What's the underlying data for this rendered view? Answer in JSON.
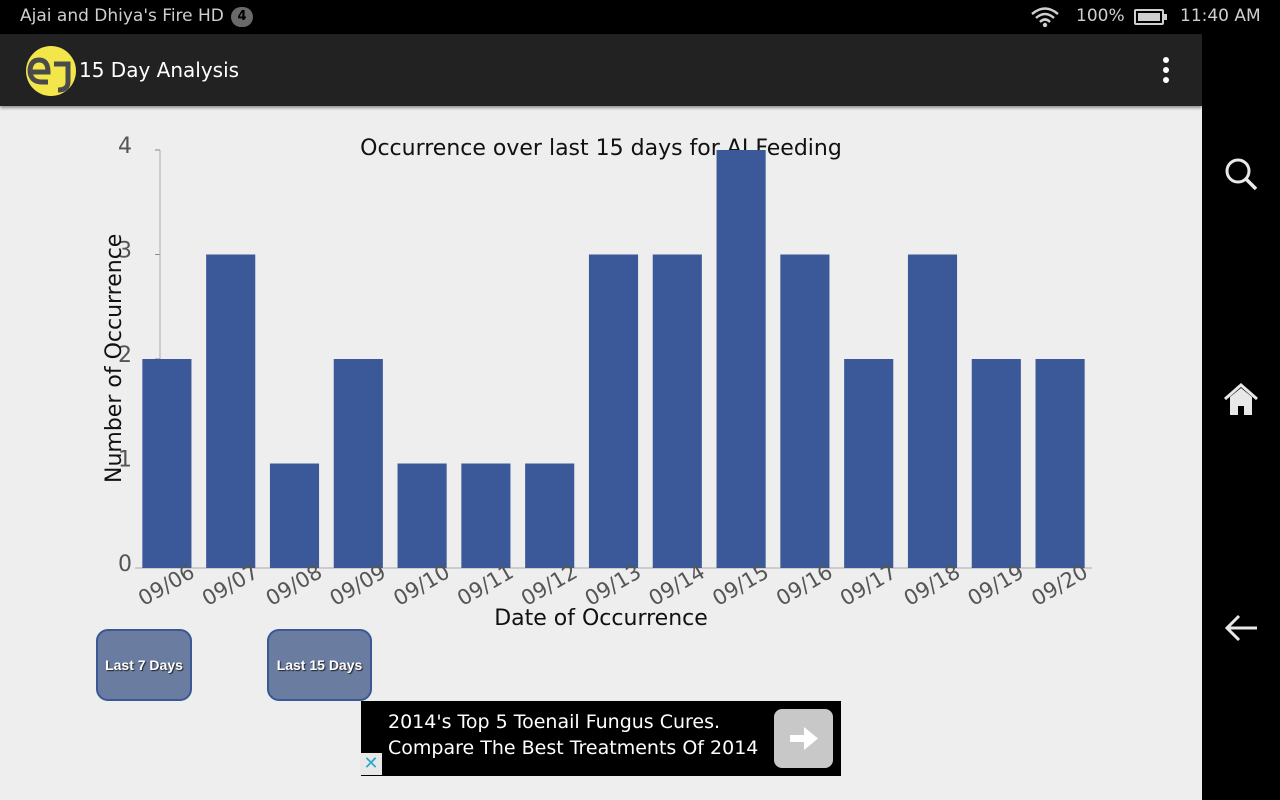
{
  "status_bar": {
    "device_name": "Ajai and Dhiya's Fire HD",
    "notification_count": "4",
    "battery": "100%",
    "time": "11:40 AM"
  },
  "action_bar": {
    "title": "15 Day Analysis",
    "logo_text": "eJ"
  },
  "buttons": {
    "last_7": "Last 7 Days",
    "last_15": "Last 15 Days"
  },
  "ad": {
    "line1": "2014's Top 5 Toenail Fungus Cures.",
    "line2": "Compare The Best Treatments Of 2014"
  },
  "colors": {
    "bar": "#3b5998",
    "button": "#6a7ca0"
  },
  "chart_data": {
    "type": "bar",
    "title": "Occurrence over last 15 days for AJ Feeding",
    "xlabel": "Date of Occurrence",
    "ylabel": "Number of Occurrence",
    "categories": [
      "09/06",
      "09/07",
      "09/08",
      "09/09",
      "09/10",
      "09/11",
      "09/12",
      "09/13",
      "09/14",
      "09/15",
      "09/16",
      "09/17",
      "09/18",
      "09/19",
      "09/20"
    ],
    "values": [
      2,
      3,
      1,
      2,
      1,
      1,
      1,
      3,
      3,
      4,
      3,
      2,
      3,
      2,
      2
    ],
    "ylim": [
      0,
      4
    ],
    "y_ticks": [
      "0",
      "1",
      "2",
      "3",
      "4"
    ],
    "grid": false,
    "legend": "none"
  }
}
